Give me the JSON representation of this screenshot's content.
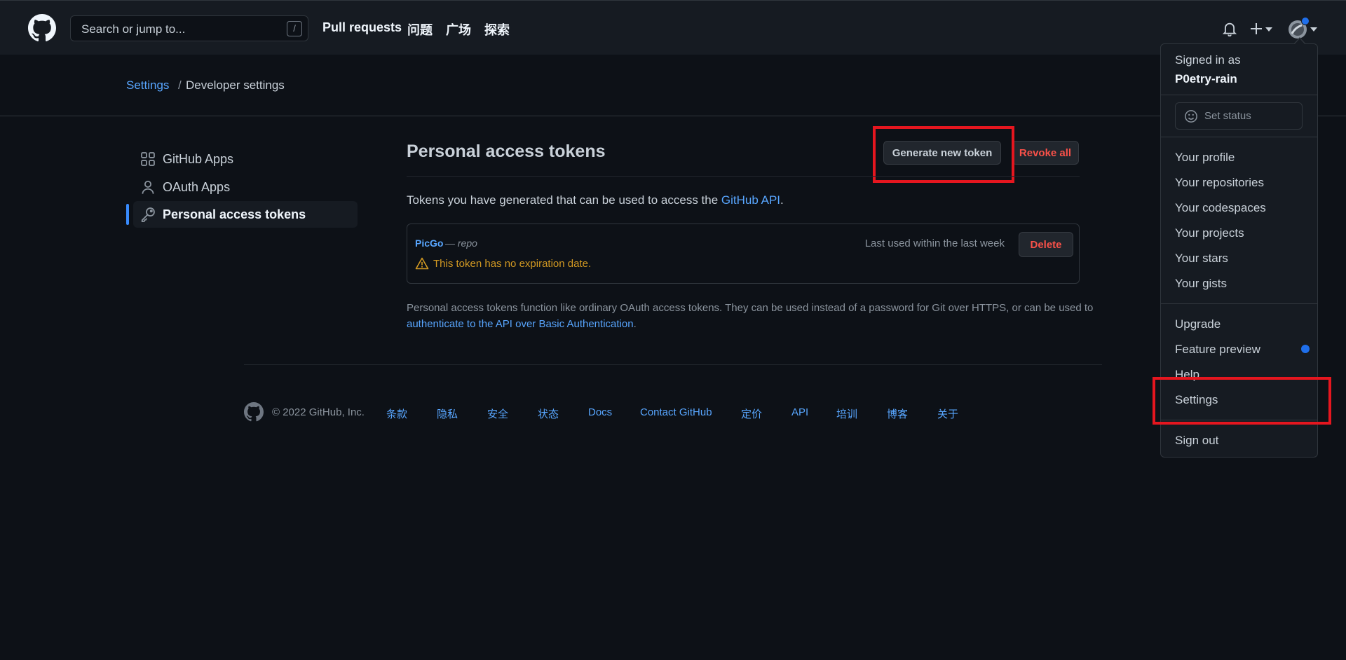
{
  "header": {
    "search_placeholder": "Search or jump to...",
    "search_key": "/",
    "nav": [
      "Pull requests",
      "问题",
      "广场",
      "探索"
    ],
    "plus_label": "+",
    "colors": {
      "bg": "#161b22",
      "link": "#58a6ff",
      "notification_dot": "#1f6feb"
    }
  },
  "breadcrumb": {
    "settings": "Settings",
    "separator": "/",
    "current": "Developer settings"
  },
  "sidebar": {
    "items": [
      {
        "label": "GitHub Apps",
        "icon": "apps-icon"
      },
      {
        "label": "OAuth Apps",
        "icon": "person-icon"
      },
      {
        "label": "Personal access tokens",
        "icon": "key-icon",
        "active": true
      }
    ]
  },
  "main": {
    "title": "Personal access tokens",
    "generate_button": "Generate new token",
    "revoke_button": "Revoke all",
    "intro_prefix": "Tokens you have generated that can be used to access the ",
    "intro_link": "GitHub API",
    "intro_suffix": ".",
    "token": {
      "name": "PicGo",
      "scope": "— repo",
      "warning": "This token has no expiration date.",
      "last_used": "Last used within the last week",
      "delete_button": "Delete"
    },
    "note_text": "Personal access tokens function like ordinary OAuth access tokens. They can be used instead of a password for Git over HTTPS, or can be used to",
    "note_link": "authenticate to the API over Basic Authentication",
    "note_end": "."
  },
  "footer": {
    "copyright": "© 2022 GitHub, Inc.",
    "links": [
      "条款",
      "隐私",
      "安全",
      "状态",
      "Docs",
      "Contact GitHub",
      "定价",
      "API",
      "培训",
      "博客",
      "关于"
    ]
  },
  "dropdown": {
    "signed_in_as": "Signed in as",
    "username": "P0etry-rain",
    "set_status": "Set status",
    "items_group1": [
      "Your profile",
      "Your repositories",
      "Your codespaces",
      "Your projects",
      "Your stars",
      "Your gists"
    ],
    "items_group2": [
      "Upgrade",
      "Feature preview",
      "Help",
      "Settings"
    ],
    "sign_out": "Sign out"
  }
}
